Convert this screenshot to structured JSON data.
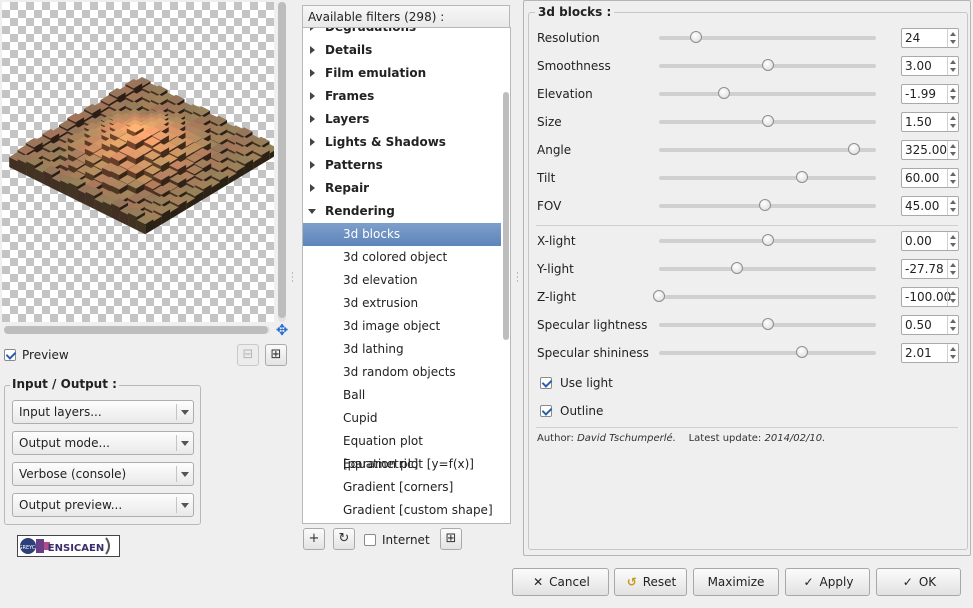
{
  "preview": {
    "label": "Preview",
    "checked": true
  },
  "io": {
    "title": "Input / Output :",
    "combos": [
      "Input layers...",
      "Output mode...",
      "Verbose (console)",
      "Output preview..."
    ]
  },
  "logo": {
    "text": "ENSICAEN",
    "badge": "GREYC"
  },
  "filters": {
    "header": "Available filters (298) :",
    "rows": [
      {
        "label": "Degradations",
        "kind": "cat",
        "open": false
      },
      {
        "label": "Details",
        "kind": "cat",
        "open": false
      },
      {
        "label": "Film emulation",
        "kind": "cat",
        "open": false
      },
      {
        "label": "Frames",
        "kind": "cat",
        "open": false
      },
      {
        "label": "Layers",
        "kind": "cat",
        "open": false
      },
      {
        "label": "Lights & Shadows",
        "kind": "cat",
        "open": false
      },
      {
        "label": "Patterns",
        "kind": "cat",
        "open": false
      },
      {
        "label": "Repair",
        "kind": "cat",
        "open": false
      },
      {
        "label": "Rendering",
        "kind": "cat",
        "open": true
      },
      {
        "label": "3d blocks",
        "kind": "item",
        "selected": true
      },
      {
        "label": "3d colored object",
        "kind": "item"
      },
      {
        "label": "3d elevation",
        "kind": "item"
      },
      {
        "label": "3d extrusion",
        "kind": "item"
      },
      {
        "label": "3d image object",
        "kind": "item"
      },
      {
        "label": "3d lathing",
        "kind": "item"
      },
      {
        "label": "3d random objects",
        "kind": "item"
      },
      {
        "label": "Ball",
        "kind": "item"
      },
      {
        "label": "Cupid",
        "kind": "item"
      },
      {
        "label": "Equation plot [parametric]",
        "kind": "item"
      },
      {
        "label": "Equation plot [y=f(x)]",
        "kind": "item"
      },
      {
        "label": "Gradient [corners]",
        "kind": "item"
      },
      {
        "label": "Gradient [custom shape]",
        "kind": "item"
      }
    ],
    "internet_label": "Internet",
    "internet_checked": false
  },
  "params": {
    "title": "3d blocks :",
    "group1": [
      {
        "label": "Resolution",
        "value": "24",
        "fraction": 0.17
      },
      {
        "label": "Smoothness",
        "value": "3.00",
        "fraction": 0.5
      },
      {
        "label": "Elevation",
        "value": "-1.99",
        "fraction": 0.3
      },
      {
        "label": "Size",
        "value": "1.50",
        "fraction": 0.5
      },
      {
        "label": "Angle",
        "value": "325.00",
        "fraction": 0.9
      },
      {
        "label": "Tilt",
        "value": "60.00",
        "fraction": 0.66
      },
      {
        "label": "FOV",
        "value": "45.00",
        "fraction": 0.49
      }
    ],
    "group2": [
      {
        "label": "X-light",
        "value": "0.00",
        "fraction": 0.5
      },
      {
        "label": "Y-light",
        "value": "-27.78",
        "fraction": 0.36
      },
      {
        "label": "Z-light",
        "value": "-100.00",
        "fraction": 0.0
      },
      {
        "label": "Specular lightness",
        "value": "0.50",
        "fraction": 0.5
      },
      {
        "label": "Specular shininess",
        "value": "2.01",
        "fraction": 0.66
      }
    ],
    "use_light": {
      "label": "Use light",
      "checked": true
    },
    "outline": {
      "label": "Outline",
      "checked": true
    },
    "author_label": "Author:",
    "author_name": "David Tschumperlé.",
    "update_label": "Latest update:",
    "update_date": "2014/02/10."
  },
  "buttons": {
    "cancel": "Cancel",
    "reset": "Reset",
    "maximize": "Maximize",
    "apply": "Apply",
    "ok": "OK"
  },
  "colors": {
    "selection": "#6a8fc3",
    "accent_check": "#2b5fad",
    "cancel_icon": "#333333",
    "reset_icon": "#c49a1a"
  }
}
